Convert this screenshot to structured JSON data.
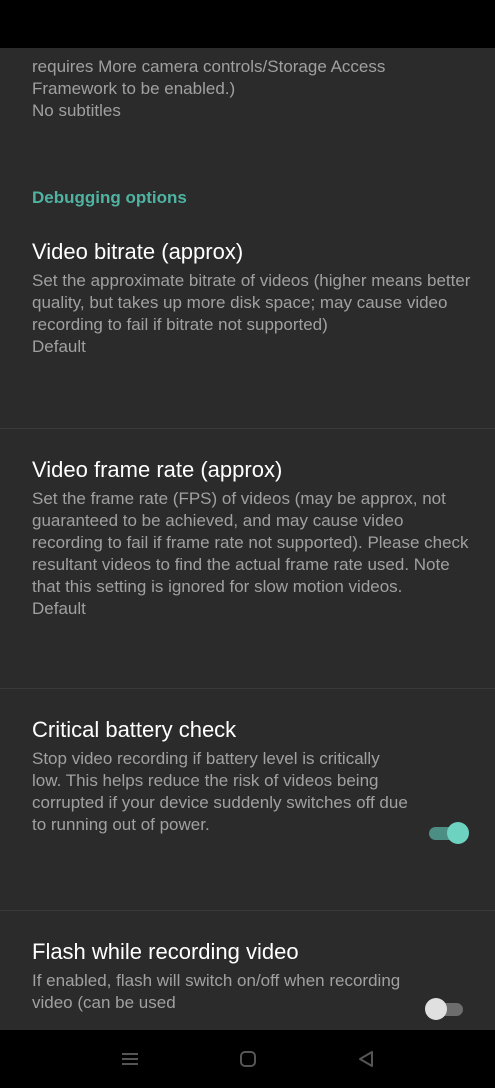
{
  "top_fragment": {
    "summary": "requires More camera controls/Storage Access Framework to be enabled.)",
    "value": "No subtitles"
  },
  "debugging": {
    "category_label": "Debugging options",
    "video_bitrate": {
      "title": "Video bitrate (approx)",
      "summary": "Set the approximate bitrate of videos (higher means better quality, but takes up more disk space; may cause video recording to fail if bitrate not supported)",
      "value": "Default"
    },
    "video_frame_rate": {
      "title": "Video frame rate (approx)",
      "summary": "Set the frame rate (FPS) of videos (may be approx, not guaranteed to be achieved, and may cause video recording to fail if frame rate not supported). Please check resultant videos to find the actual frame rate used. Note that this setting is ignored for slow motion videos.",
      "value": "Default"
    },
    "critical_battery": {
      "title": "Critical battery check",
      "summary": "Stop video recording if battery level is critically low. This helps reduce the risk of videos being corrupted if your device suddenly switches off due to running out of power.",
      "enabled": true
    },
    "flash_recording": {
      "title": "Flash while recording video",
      "summary": "If enabled, flash will switch on/off when recording video (can be used",
      "enabled": false
    }
  },
  "colors": {
    "accent": "#4fb3a2",
    "background": "#2b2b2b",
    "switch_on": "#6dd2c0"
  },
  "icons": {
    "nav_recents": "menu-icon",
    "nav_home": "home-icon",
    "nav_back": "back-triangle-icon"
  }
}
